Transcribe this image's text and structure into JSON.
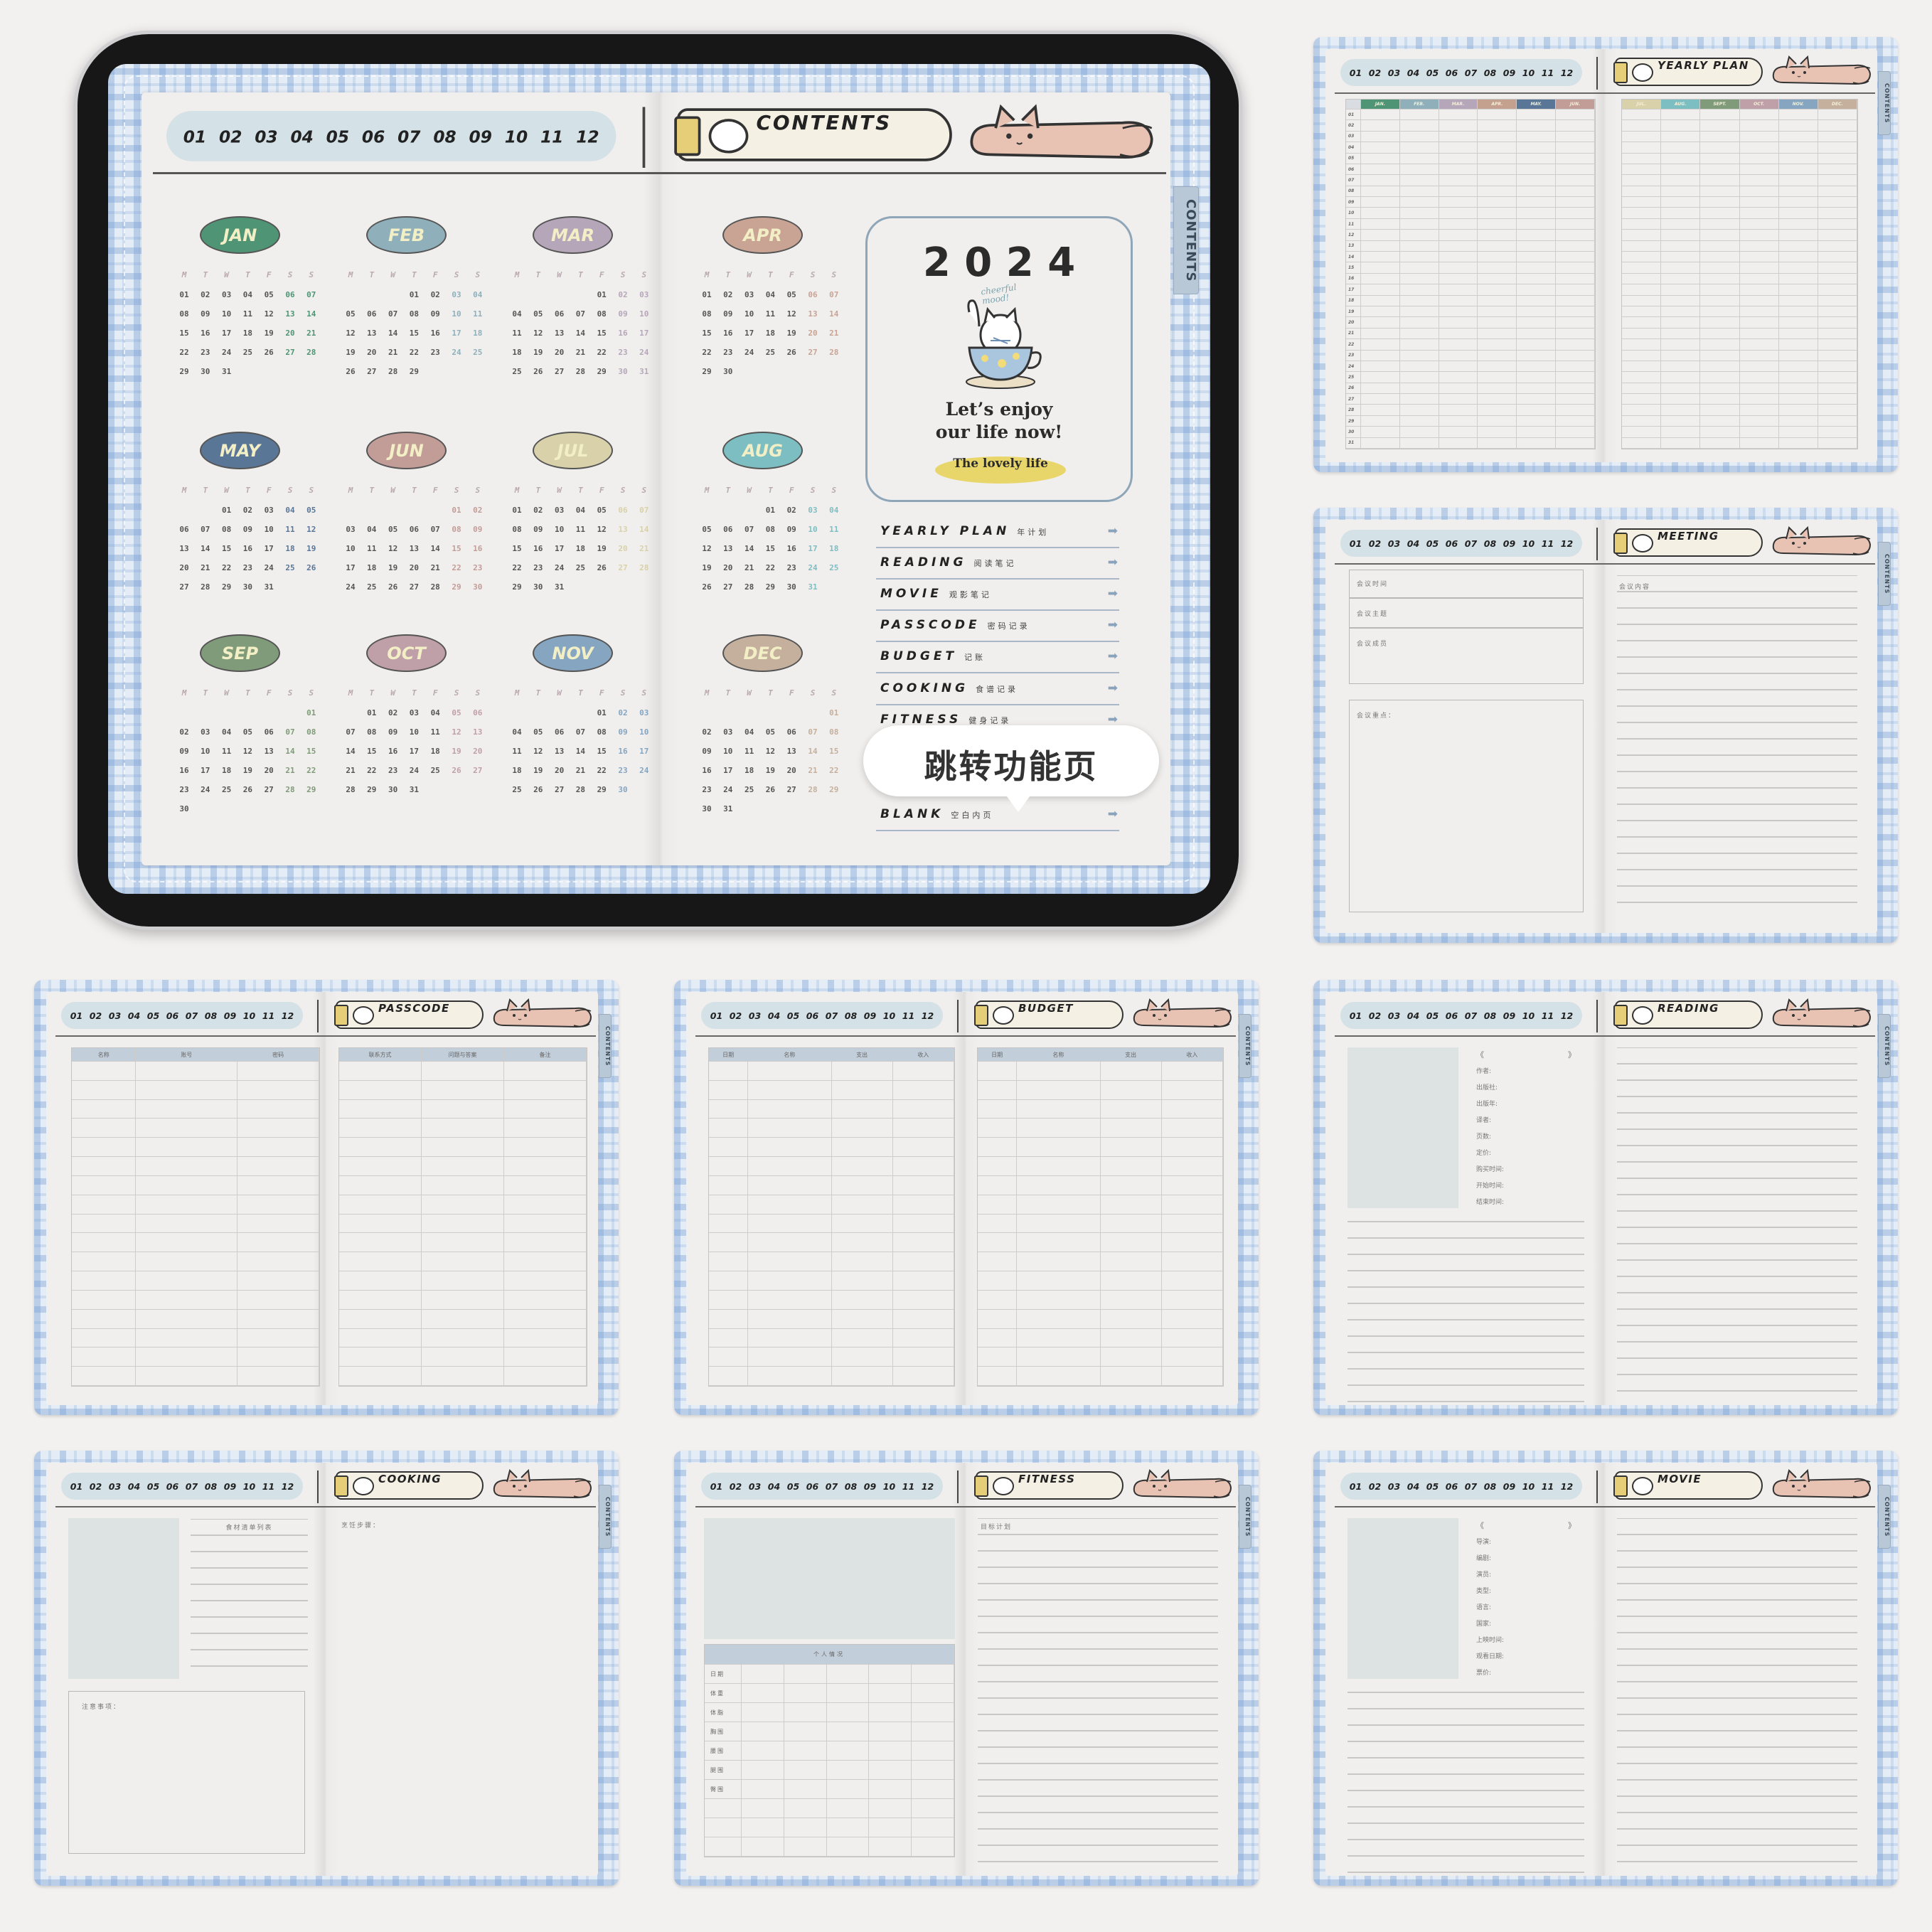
{
  "month_tabs": [
    "01",
    "02",
    "03",
    "04",
    "05",
    "06",
    "07",
    "08",
    "09",
    "10",
    "11",
    "12"
  ],
  "side_tab": "CONTENTS",
  "main": {
    "title": "CONTENTS",
    "calendar": {
      "weekdays": [
        "M",
        "T",
        "W",
        "T",
        "F",
        "S",
        "S"
      ],
      "months": [
        {
          "name": "JAN",
          "color": "#4f9474",
          "starts_on": "Mon",
          "days": 31
        },
        {
          "name": "FEB",
          "color": "#8fb0ba",
          "starts_on": "Thu",
          "days": 29
        },
        {
          "name": "MAR",
          "color": "#b6a6b9",
          "starts_on": "Fri",
          "days": 31
        },
        {
          "name": "APR",
          "color": "#c9a393",
          "starts_on": "Mon",
          "days": 30
        },
        {
          "name": "MAY",
          "color": "#5a7697",
          "starts_on": "Wed",
          "days": 31
        },
        {
          "name": "JUN",
          "color": "#c29d98",
          "starts_on": "Sat",
          "days": 30
        },
        {
          "name": "JUL",
          "color": "#d8d1aa",
          "starts_on": "Mon",
          "days": 31
        },
        {
          "name": "AUG",
          "color": "#7dbec2",
          "starts_on": "Thu",
          "days": 31
        },
        {
          "name": "SEP",
          "color": "#7f9b79",
          "starts_on": "Sun",
          "days": 30
        },
        {
          "name": "OCT",
          "color": "#c0a0a8",
          "starts_on": "Tue",
          "days": 31
        },
        {
          "name": "NOV",
          "color": "#85a5c1",
          "starts_on": "Fri",
          "days": 30
        },
        {
          "name": "DEC",
          "color": "#c5b09d",
          "starts_on": "Sun",
          "days": 31
        }
      ]
    },
    "card": {
      "year": "2 0 2 4",
      "handwriting": "cheerful mood!",
      "line1": "Let’s enjoy",
      "line2": "our life now!",
      "badge": "The lovely life",
      "badge_color": "#e8d66a"
    },
    "menu": [
      {
        "en": "YEARLY PLAN",
        "zh": "年计划"
      },
      {
        "en": "READING",
        "zh": "阅读笔记"
      },
      {
        "en": "MOVIE",
        "zh": "观影笔记"
      },
      {
        "en": "PASSCODE",
        "zh": "密码记录"
      },
      {
        "en": "BUDGET",
        "zh": "记账"
      },
      {
        "en": "COOKING",
        "zh": "食谱记录"
      },
      {
        "en": "FITNESS",
        "zh": "健身记录"
      },
      {
        "en": "BLANK",
        "zh": "空白内页"
      }
    ],
    "arrow_icon": "arrow-right-icon",
    "tooltip": "跳转功能页"
  },
  "spreads": {
    "yearly": {
      "title": "YEARLY PLAN",
      "left_headers": [
        "JAN.",
        "FEB.",
        "MAR.",
        "APR.",
        "MAY.",
        "JUN."
      ],
      "right_headers": [
        "JUL.",
        "AUG.",
        "SEPT.",
        "OCT.",
        "NOV.",
        "DEC."
      ],
      "header_colors_left": [
        "#4f9474",
        "#8fb0ba",
        "#b6a6b9",
        "#c4a08e",
        "#5a7697",
        "#c29d98"
      ],
      "header_colors_right": [
        "#d8d1aa",
        "#7dbec2",
        "#7f9b79",
        "#c0a0a8",
        "#85a5c1",
        "#c5b09d"
      ],
      "row_labels": [
        "01",
        "02",
        "03",
        "04",
        "05",
        "06",
        "07",
        "08",
        "09",
        "10",
        "11",
        "12",
        "13",
        "14",
        "15",
        "16",
        "17",
        "18",
        "19",
        "20",
        "21",
        "22",
        "23",
        "24",
        "25",
        "26",
        "27",
        "28",
        "29",
        "30",
        "31"
      ]
    },
    "meeting": {
      "title": "MEETING",
      "fields": [
        "会议时间",
        "会议主题",
        "会议成员"
      ],
      "notes_label": "会议重点：",
      "content_label": "会议内容"
    },
    "passcode": {
      "title": "PASSCODE",
      "left_headers": [
        "名称",
        "账号",
        "密码"
      ],
      "right_headers": [
        "联系方式",
        "问题与答案",
        "备注"
      ]
    },
    "budget": {
      "title": "BUDGET",
      "left_headers": [
        "日期",
        "名称",
        "支出",
        "收入"
      ],
      "right_headers": [
        "日期",
        "名称",
        "支出",
        "收入"
      ]
    },
    "reading": {
      "title": "READING",
      "title_open": "《",
      "title_close": "》",
      "fields": [
        "作者:",
        "出版社:",
        "出版年:",
        "译者:",
        "页数:",
        "定价:",
        "购买时间:",
        "开始时间:",
        "结束时间:"
      ]
    },
    "cooking": {
      "title": "COOKING",
      "ingredients_label": "食材清单列表",
      "notes_label": "注意事项：",
      "steps_label": "烹饪步骤："
    },
    "fitness": {
      "title": "FITNESS",
      "table_title": "个人情况",
      "rows": [
        "日期",
        "体重",
        "体脂",
        "胸围",
        "腰围",
        "腿围",
        "臀围"
      ],
      "plan_label": "目标计划"
    },
    "movie": {
      "title": "MOVIE",
      "title_open": "《",
      "title_close": "》",
      "fields": [
        "导演:",
        "编剧:",
        "演员:",
        "类型:",
        "语言:",
        "国家:",
        "上映时间:",
        "观看日期:",
        "票价:"
      ]
    }
  }
}
